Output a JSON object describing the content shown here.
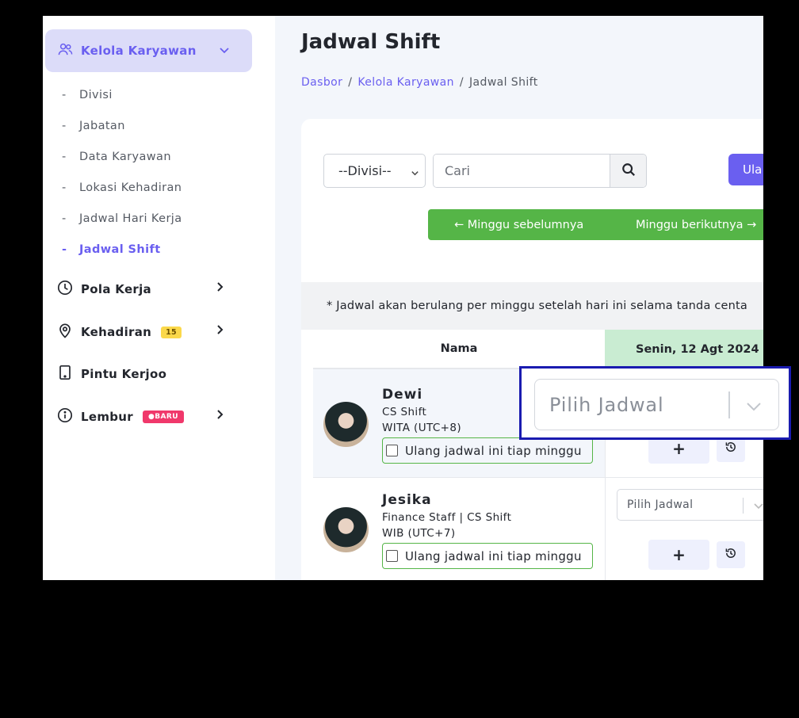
{
  "sidebar": {
    "group_label": "Kelola Karyawan",
    "sub_items": [
      "Divisi",
      "Jabatan",
      "Data Karyawan",
      "Lokasi Kehadiran",
      "Jadwal Hari Kerja",
      "Jadwal Shift"
    ],
    "active_sub_item": "Jadwal Shift",
    "menu": {
      "pola_kerja": "Pola Kerja",
      "kehadiran": "Kehadiran",
      "kehadiran_badge": "15",
      "pintu_kerjoo": "Pintu Kerjoo",
      "lembur": "Lembur",
      "lembur_badge": "●BARU"
    }
  },
  "page": {
    "title": "Jadwal Shift",
    "breadcrumb": [
      "Dasbor",
      "Kelola Karyawan",
      "Jadwal Shift"
    ]
  },
  "toolbar": {
    "division_select": "--Divisi--",
    "search_placeholder": "Cari",
    "ulang_button": "Ula",
    "prev_week": "← Minggu sebelumnya",
    "next_week": "Minggu berikutnya →"
  },
  "notice": "* Jadwal akan berulang per minggu setelah hari ini selama tanda centa",
  "table": {
    "col_name": "Nama",
    "col_day": "Senin, 12 Agt 2024",
    "rows": [
      {
        "name": "Dewi",
        "position": "CS Shift",
        "timezone": "WITA (UTC+8)",
        "repeat_label": "Ulang jadwal ini tiap minggu",
        "schedule_placeholder": "Pilih Jadwal",
        "add_label": "+"
      },
      {
        "name": "Jesika",
        "position": "Finance Staff | CS Shift",
        "timezone": "WIB (UTC+7)",
        "repeat_label": "Ulang jadwal ini tiap minggu",
        "schedule_placeholder": "Pilih Jadwal",
        "add_label": "+"
      }
    ]
  },
  "zoom": {
    "placeholder": "Pilih Jadwal"
  },
  "colors": {
    "accent": "#6a5ff0",
    "green": "#55b547",
    "highlight_border": "#1a1bb0"
  }
}
